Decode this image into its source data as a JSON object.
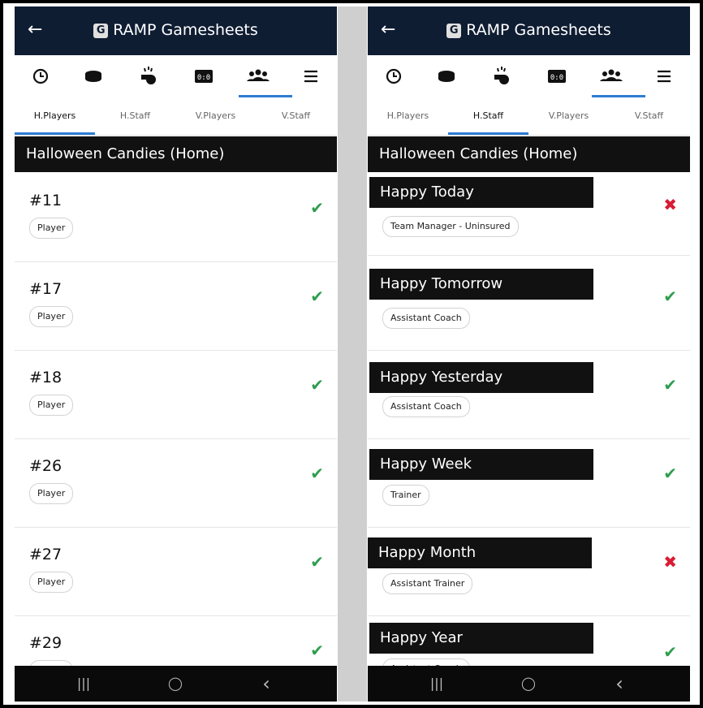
{
  "app": {
    "title": "RAMP Gamesheets"
  },
  "accent": "#2e7cd3",
  "status_colors": {
    "ok": "#2e9e4f",
    "error": "#d81c34"
  },
  "icons": [
    "clock-icon",
    "puck-icon",
    "whistle-icon",
    "scoreboard-icon",
    "team-icon",
    "menu-icon"
  ],
  "tabs": [
    "H.Players",
    "H.Staff",
    "V.Players",
    "V.Staff"
  ],
  "left": {
    "active_tab": "H.Players",
    "team_header": "Halloween Candies (Home)",
    "players": [
      {
        "number": "#11",
        "role": "Player",
        "status": "ok"
      },
      {
        "number": "#17",
        "role": "Player",
        "status": "ok"
      },
      {
        "number": "#18",
        "role": "Player",
        "status": "ok"
      },
      {
        "number": "#26",
        "role": "Player",
        "status": "ok"
      },
      {
        "number": "#27",
        "role": "Player",
        "status": "ok"
      },
      {
        "number": "#29",
        "role": "Player",
        "status": "ok"
      }
    ]
  },
  "right": {
    "active_tab": "H.Staff",
    "team_header": "Halloween Candies (Home)",
    "staff": [
      {
        "name": "Happy Today",
        "role": "Team Manager - Uninsured",
        "status": "error"
      },
      {
        "name": "Happy Tomorrow",
        "role": "Assistant Coach",
        "status": "ok"
      },
      {
        "name": "Happy Yesterday",
        "role": "Assistant Coach",
        "status": "ok"
      },
      {
        "name": "Happy Week",
        "role": "Trainer",
        "status": "ok"
      },
      {
        "name": "Happy Month",
        "role": "Assistant Trainer",
        "status": "error"
      },
      {
        "name": "Happy Year",
        "role": "Assistant Coach",
        "status": "ok"
      }
    ]
  },
  "status_glyphs": {
    "ok": "✔",
    "error": "✖"
  },
  "nav": {
    "recent": "|||",
    "home": "◯",
    "back": "‹"
  }
}
